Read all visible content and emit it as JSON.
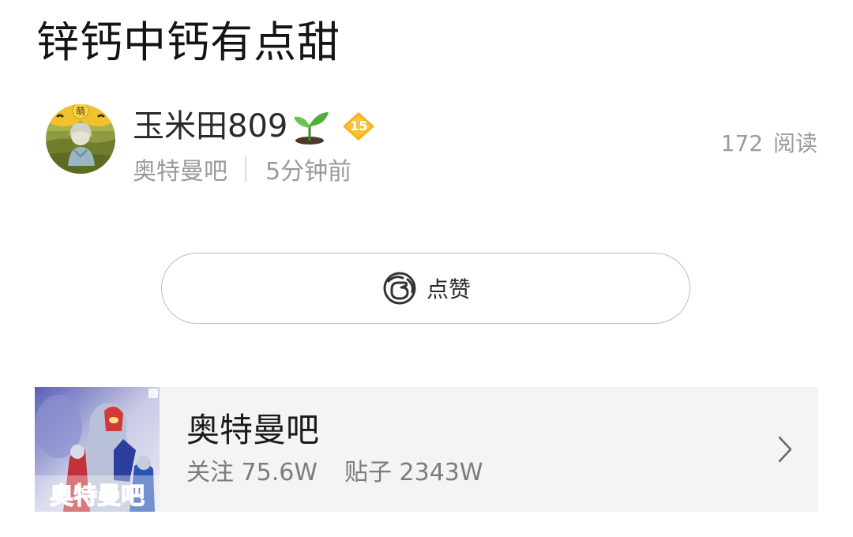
{
  "post": {
    "title": "锌钙中钙有点甜"
  },
  "author": {
    "name": "玉米田809",
    "level": "15",
    "forum": "奥特曼吧",
    "time_ago": "5分钟前",
    "avatar_badge": "萌"
  },
  "stats": {
    "read_count": "172 阅读"
  },
  "actions": {
    "like_label": "点赞"
  },
  "forum_card": {
    "name": "奥特曼吧",
    "follow_text": "关注 75.6W",
    "posts_text": "贴子 2343W",
    "thumb_caption": "奥特曼吧"
  },
  "colors": {
    "level_badge": "#f5b21d",
    "text_primary": "#1a1a1a",
    "text_secondary": "#9a9a9a",
    "card_bg": "#f4f4f4"
  },
  "icons": [
    "sprout-icon",
    "level-badge-icon",
    "like-icon",
    "chevron-right-icon"
  ]
}
